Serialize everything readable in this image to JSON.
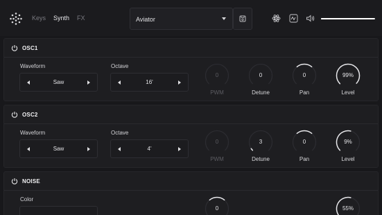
{
  "tabs": [
    {
      "label": "Keys",
      "active": false
    },
    {
      "label": "Synth",
      "active": true
    },
    {
      "label": "FX",
      "active": false
    }
  ],
  "preset": {
    "value": "Aviator"
  },
  "header_icons": [
    "atom-icon",
    "waveform-display-icon",
    "speaker-icon"
  ],
  "master_volume_fraction": 0.99,
  "colors": {
    "background": "#18181b",
    "panel": "#1e1e21",
    "text": "#e6e6e8",
    "muted": "#5c5c62",
    "arc": "#e8e8eb",
    "arc_track": "#2c2c31"
  },
  "sections": {
    "osc1": {
      "title": "OSC1",
      "waveform": {
        "label": "Waveform",
        "value": "Saw"
      },
      "octave": {
        "label": "Octave",
        "value": "16'"
      },
      "knobs": [
        {
          "label": "PWM",
          "value": "0",
          "fraction": 0,
          "disabled": true
        },
        {
          "label": "Detune",
          "value": "0",
          "fraction": 0.0,
          "disabled": false
        },
        {
          "label": "Pan",
          "value": "0",
          "fraction": 0.5,
          "disabled": false
        },
        {
          "label": "Level",
          "value": "99%",
          "fraction": 0.99,
          "disabled": false
        }
      ]
    },
    "osc2": {
      "title": "OSC2",
      "waveform": {
        "label": "Waveform",
        "value": "Saw"
      },
      "octave": {
        "label": "Octave",
        "value": "4'"
      },
      "knobs": [
        {
          "label": "PWM",
          "value": "0",
          "fraction": 0,
          "disabled": true
        },
        {
          "label": "Detune",
          "value": "3",
          "fraction": 0.04,
          "disabled": false
        },
        {
          "label": "Pan",
          "value": "0",
          "fraction": 0.5,
          "disabled": false
        },
        {
          "label": "Level",
          "value": "9%",
          "fraction": 0.55,
          "disabled": false
        }
      ]
    },
    "noise": {
      "title": "NOISE",
      "color": {
        "label": "Color"
      },
      "knobs": [
        {
          "value": "0",
          "fraction": 0.5,
          "disabled": false
        },
        {
          "value": "55%",
          "fraction": 0.55,
          "disabled": false
        }
      ]
    }
  }
}
